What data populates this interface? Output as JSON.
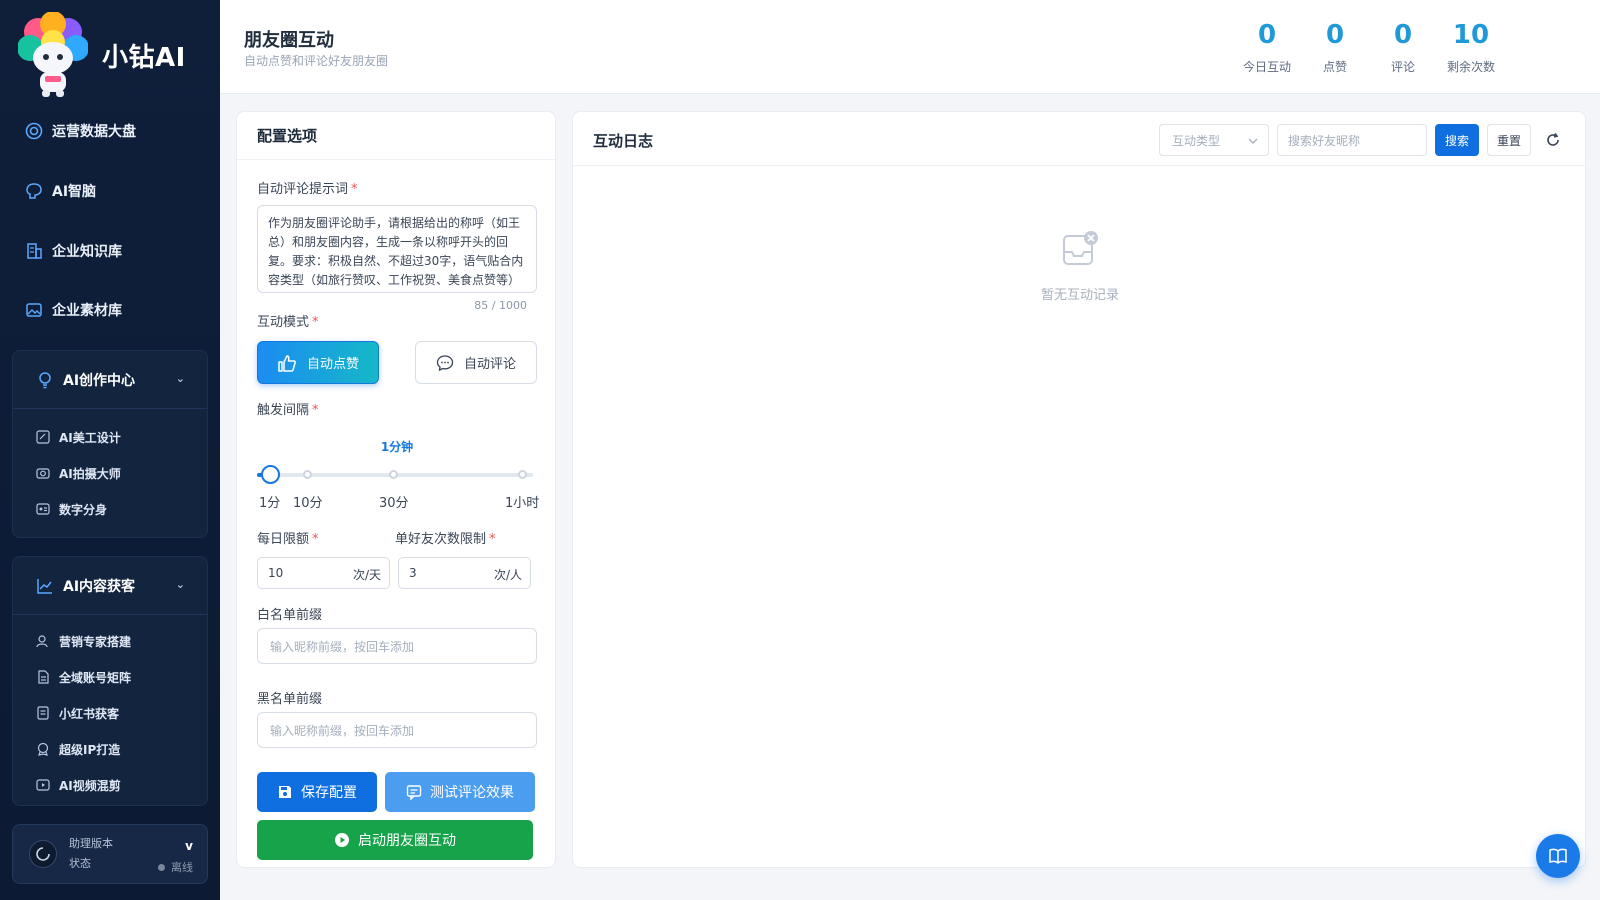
{
  "sidebar": {
    "brand": "小钻AI",
    "nav": [
      {
        "label": "运营数据大盘",
        "icon": "dashboard-icon"
      },
      {
        "label": "AI智脑",
        "icon": "brain-icon"
      },
      {
        "label": "企业知识库",
        "icon": "building-icon"
      },
      {
        "label": "企业素材库",
        "icon": "image-icon"
      }
    ],
    "groups": [
      {
        "label": "AI创作中心",
        "icon": "bulb-icon",
        "items": [
          "AI美工设计",
          "AI拍摄大师",
          "数字分身"
        ]
      },
      {
        "label": "AI内容获客",
        "icon": "trend-icon",
        "items": [
          "营销专家搭建",
          "全域账号矩阵",
          "小红书获客",
          "超级IP打造",
          "AI视频混剪"
        ]
      }
    ],
    "assistant": {
      "title": "助理版本",
      "status_label": "状态",
      "version": "v",
      "status": "离线"
    }
  },
  "header": {
    "title": "朋友圈互动",
    "subtitle": "自动点赞和评论好友朋友圈",
    "stats": [
      {
        "value": "0",
        "label": "今日互动"
      },
      {
        "value": "0",
        "label": "点赞"
      },
      {
        "value": "0",
        "label": "评论"
      },
      {
        "value": "10",
        "label": "剩余次数"
      }
    ]
  },
  "config": {
    "title": "配置选项",
    "prompt_label": "自动评论提示词",
    "prompt_value": "作为朋友圈评论助手，请根据给出的称呼（如王总）和朋友圈内容，生成一条以称呼开头的回复。要求：积极自然、不超过30字，语气贴合内容类型（如旅行赞叹、工作祝贺、美食点赞等）",
    "prompt_counter": "85 / 1000",
    "mode_label": "互动模式",
    "mode_like": "自动点赞",
    "mode_comment": "自动评论",
    "interval_label": "触发间隔",
    "interval_value": "1分钟",
    "interval_fraction": 0.0,
    "interval_marks": [
      "1分",
      "10分",
      "30分",
      "1小时"
    ],
    "daily_label": "每日限额",
    "daily_value": "10",
    "daily_unit": "次/天",
    "per_friend_label": "单好友次数限制",
    "per_friend_value": "3",
    "per_friend_unit": "次/人",
    "whitelist_label": "白名单前缀",
    "whitelist_placeholder": "输入昵称前缀，按回车添加",
    "blacklist_label": "黑名单前缀",
    "blacklist_placeholder": "输入昵称前缀，按回车添加",
    "save_label": "保存配置",
    "test_label": "测试评论效果",
    "start_label": "启动朋友圈互动"
  },
  "log": {
    "title": "互动日志",
    "type_placeholder": "互动类型",
    "search_placeholder": "搜索好友昵称",
    "search_label": "搜索",
    "reset_label": "重置",
    "empty_text": "暂无互动记录"
  },
  "colors": {
    "accent": "#0f6fe0",
    "stat": "#1f9ad6",
    "start": "#16a34a",
    "sidebar": "#0f1f3a"
  }
}
